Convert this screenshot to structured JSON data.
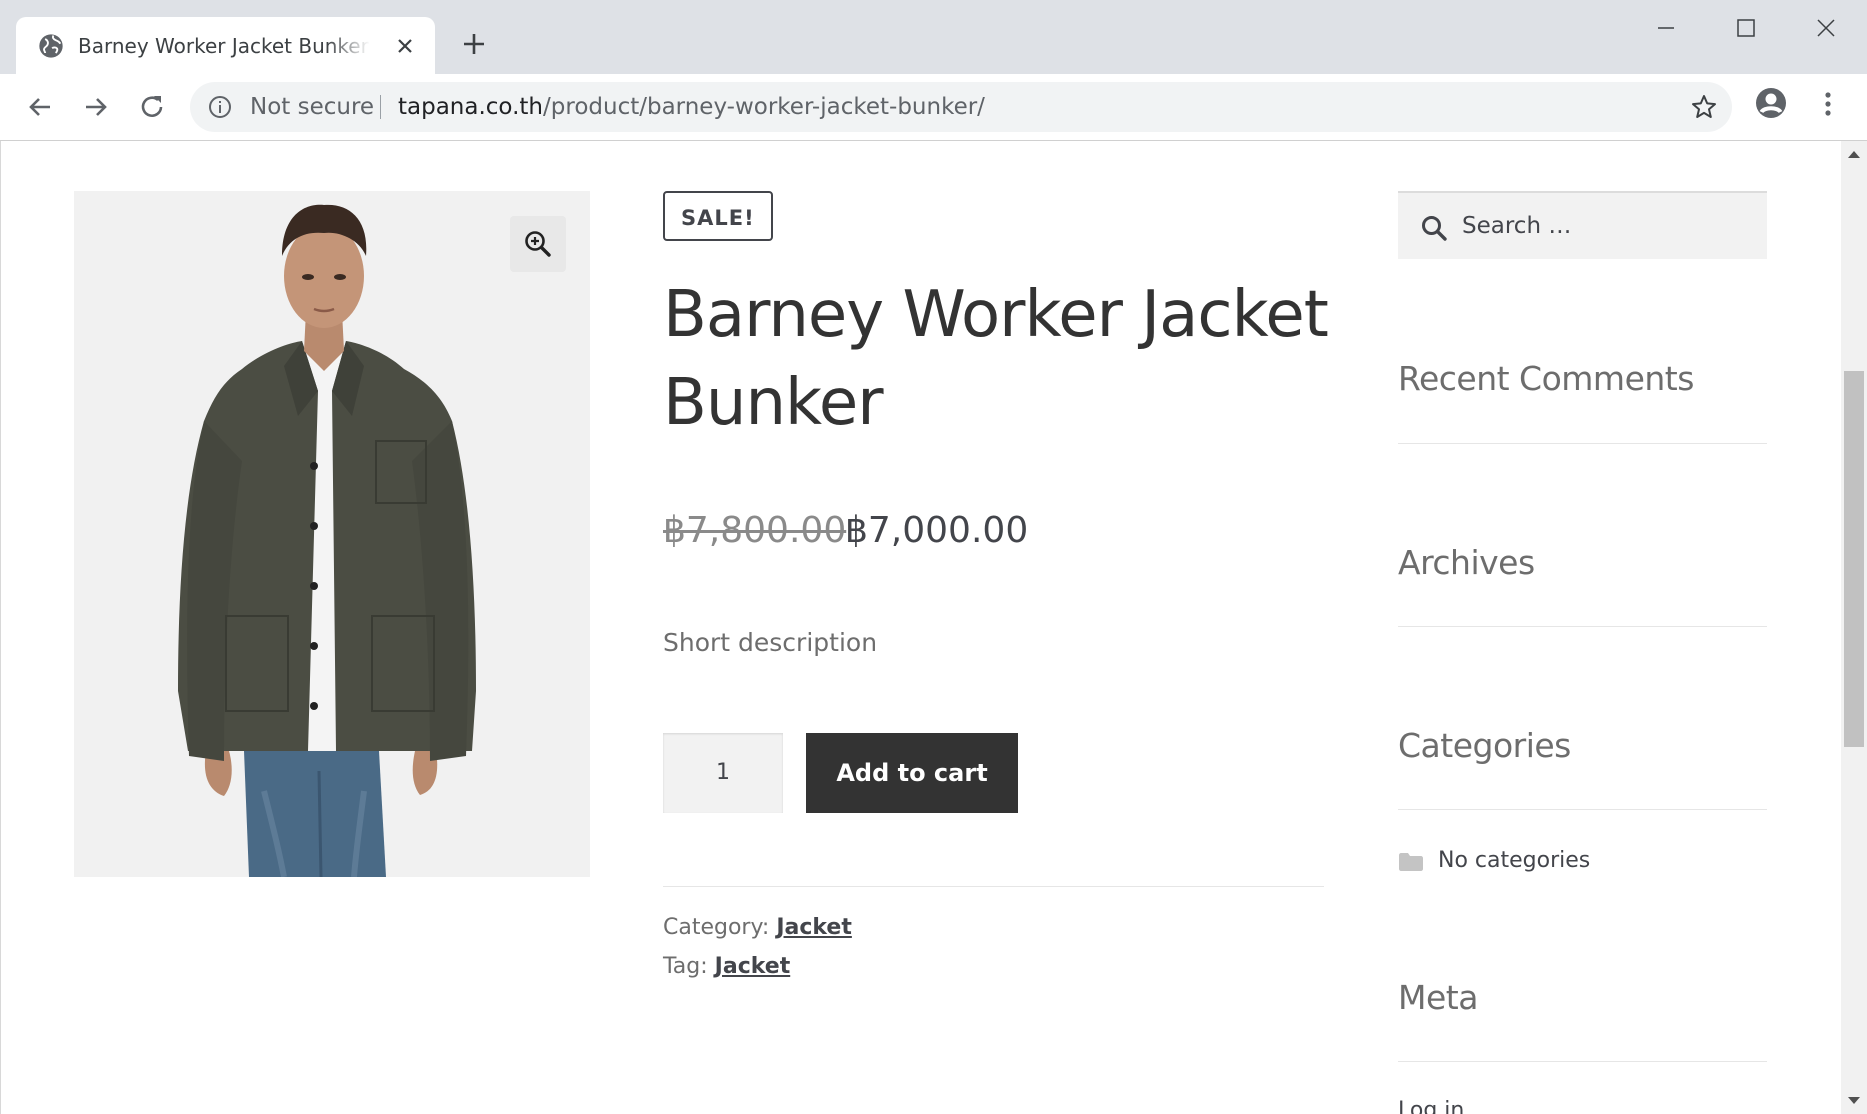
{
  "browser": {
    "tab_title": "Barney Worker Jacket Bunker – Tapana",
    "new_tab_symbol": "+",
    "security_label": "Not secure",
    "url_host": "tapana.co.th",
    "url_path": "/product/barney-worker-jacket-bunker/"
  },
  "product": {
    "sale_badge": "SALE!",
    "title": "Barney Worker Jacket Bunker",
    "price_old": "฿7,800.00",
    "price_new": "฿7,000.00",
    "short_description": "Short description",
    "quantity": "1",
    "add_to_cart_label": "Add to cart",
    "category_label": "Category:",
    "category_value": "Jacket",
    "tag_label": "Tag:",
    "tag_value": "Jacket"
  },
  "sidebar": {
    "search_placeholder": "Search …",
    "widgets": [
      {
        "title": "Recent Comments"
      },
      {
        "title": "Archives"
      },
      {
        "title": "Categories"
      },
      {
        "title": "Meta"
      }
    ],
    "categories_empty": "No categories",
    "meta_first_item": "Log in"
  },
  "icons": {
    "tab": "globe-icon",
    "close": "close-icon",
    "back": "arrow-left-icon",
    "forward": "arrow-right-icon",
    "reload": "reload-icon",
    "info": "info-icon",
    "star": "star-icon",
    "profile": "profile-icon",
    "menu": "kebab-menu-icon",
    "zoom": "zoom-in-icon",
    "search": "search-icon",
    "folder": "folder-icon"
  },
  "colors": {
    "chrome_bg": "#dee1e6",
    "omnibox_bg": "#f1f3f4",
    "button_dark": "#333333",
    "text_dark": "#43454b",
    "text_muted": "#6d6d6d"
  }
}
